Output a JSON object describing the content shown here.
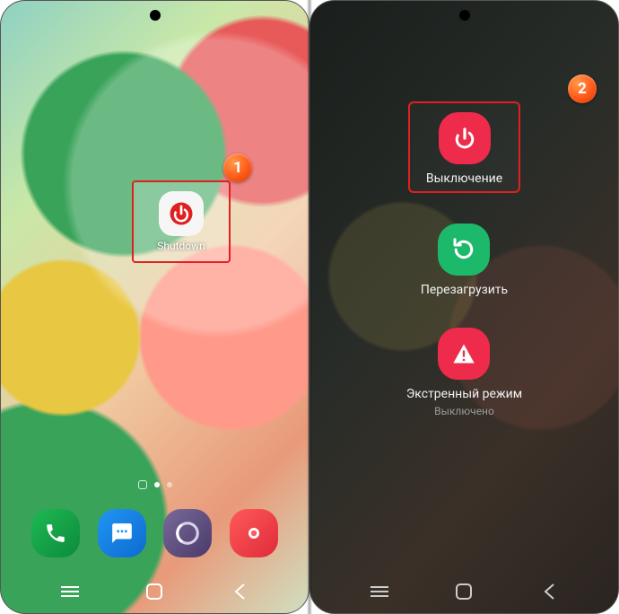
{
  "left": {
    "app": {
      "label": "Shutdown"
    },
    "badge": "1"
  },
  "right": {
    "badge": "2",
    "options": {
      "power_off": {
        "label": "Выключение"
      },
      "restart": {
        "label": "Перезагрузить"
      },
      "emergency": {
        "label": "Экстренный режим",
        "sub": "Выключено"
      }
    }
  },
  "colors": {
    "highlight_border": "#e02020",
    "badge_gradient_from": "#ff9a4a",
    "badge_gradient_to": "#d63a00"
  }
}
